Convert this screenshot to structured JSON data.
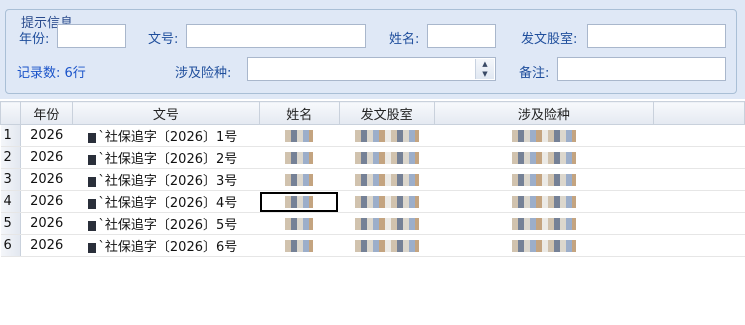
{
  "group_title": "提示信息",
  "form": {
    "year_label": "年份:",
    "doc_no_label": "文号:",
    "name_label": "姓名:",
    "office_label": "发文股室:",
    "record_count": "记录数: 6行",
    "insurance_label": "涉及险种:",
    "note_label": "备注:",
    "year_value": "",
    "doc_no_value": "",
    "name_value": "",
    "office_value": "",
    "note_value": ""
  },
  "table": {
    "columns": [
      "年份",
      "文号",
      "姓名",
      "发文股室",
      "涉及险种"
    ],
    "rows": [
      {
        "rn": "1",
        "year": "2026",
        "doc": "`社保追字〔2026〕1号"
      },
      {
        "rn": "2",
        "year": "2026",
        "doc": "`社保追字〔2026〕2号"
      },
      {
        "rn": "3",
        "year": "2026",
        "doc": "`社保追字〔2026〕3号"
      },
      {
        "rn": "4",
        "year": "2026",
        "doc": "`社保追字〔2026〕4号"
      },
      {
        "rn": "5",
        "year": "2026",
        "doc": "`社保追字〔2026〕5号"
      },
      {
        "rn": "6",
        "year": "2026",
        "doc": "`社保追字〔2026〕6号"
      }
    ]
  }
}
